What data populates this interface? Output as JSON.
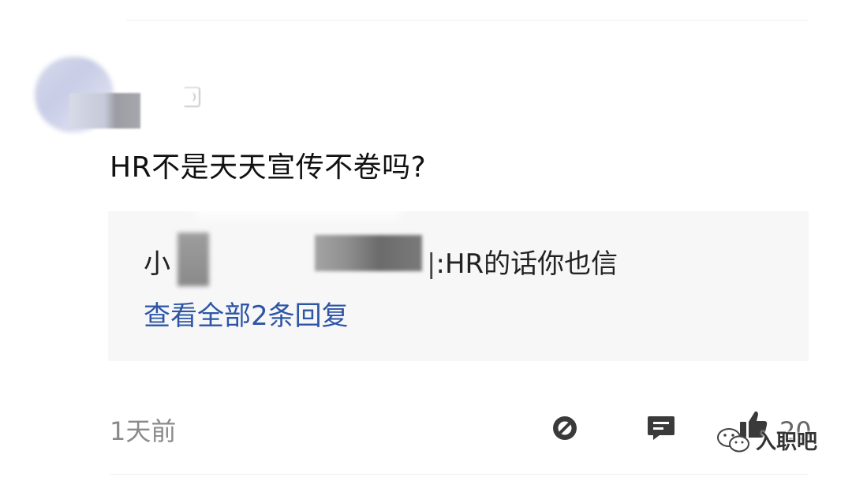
{
  "comment": {
    "text": "HR不是天天宣传不卷吗?"
  },
  "reply_preview": {
    "name_visible_start": "小",
    "name_visible_end": "|",
    "separator": ":",
    "reply_text": "HR的话你也信",
    "view_all_label": "查看全部2条回复"
  },
  "footer": {
    "time": "1天前",
    "like_count": "20",
    "share_icon": "share-arrow-icon",
    "comment_icon": "comment-bubble-icon",
    "like_icon": "thumbs-up-icon"
  },
  "watermark": {
    "text": "入职吧",
    "icon": "wechat-logo-icon"
  },
  "colors": {
    "link": "#2c55a6",
    "muted": "#8a8a8a",
    "reply_bg": "#f7f7f8"
  }
}
